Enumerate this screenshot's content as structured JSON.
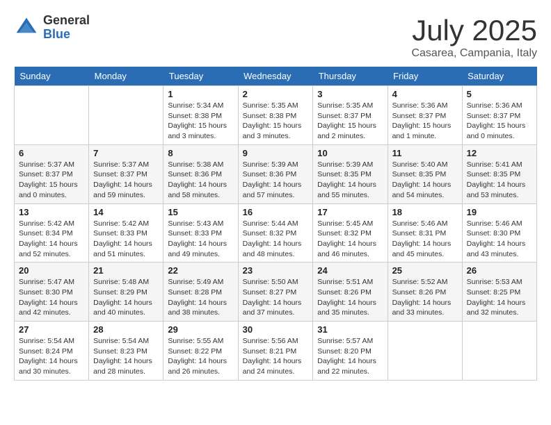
{
  "header": {
    "logo_general": "General",
    "logo_blue": "Blue",
    "month": "July 2025",
    "location": "Casarea, Campania, Italy"
  },
  "weekdays": [
    "Sunday",
    "Monday",
    "Tuesday",
    "Wednesday",
    "Thursday",
    "Friday",
    "Saturday"
  ],
  "weeks": [
    [
      {
        "day": "",
        "info": ""
      },
      {
        "day": "",
        "info": ""
      },
      {
        "day": "1",
        "info": "Sunrise: 5:34 AM\nSunset: 8:38 PM\nDaylight: 15 hours\nand 3 minutes."
      },
      {
        "day": "2",
        "info": "Sunrise: 5:35 AM\nSunset: 8:38 PM\nDaylight: 15 hours\nand 3 minutes."
      },
      {
        "day": "3",
        "info": "Sunrise: 5:35 AM\nSunset: 8:37 PM\nDaylight: 15 hours\nand 2 minutes."
      },
      {
        "day": "4",
        "info": "Sunrise: 5:36 AM\nSunset: 8:37 PM\nDaylight: 15 hours\nand 1 minute."
      },
      {
        "day": "5",
        "info": "Sunrise: 5:36 AM\nSunset: 8:37 PM\nDaylight: 15 hours\nand 0 minutes."
      }
    ],
    [
      {
        "day": "6",
        "info": "Sunrise: 5:37 AM\nSunset: 8:37 PM\nDaylight: 15 hours\nand 0 minutes."
      },
      {
        "day": "7",
        "info": "Sunrise: 5:37 AM\nSunset: 8:37 PM\nDaylight: 14 hours\nand 59 minutes."
      },
      {
        "day": "8",
        "info": "Sunrise: 5:38 AM\nSunset: 8:36 PM\nDaylight: 14 hours\nand 58 minutes."
      },
      {
        "day": "9",
        "info": "Sunrise: 5:39 AM\nSunset: 8:36 PM\nDaylight: 14 hours\nand 57 minutes."
      },
      {
        "day": "10",
        "info": "Sunrise: 5:39 AM\nSunset: 8:35 PM\nDaylight: 14 hours\nand 55 minutes."
      },
      {
        "day": "11",
        "info": "Sunrise: 5:40 AM\nSunset: 8:35 PM\nDaylight: 14 hours\nand 54 minutes."
      },
      {
        "day": "12",
        "info": "Sunrise: 5:41 AM\nSunset: 8:35 PM\nDaylight: 14 hours\nand 53 minutes."
      }
    ],
    [
      {
        "day": "13",
        "info": "Sunrise: 5:42 AM\nSunset: 8:34 PM\nDaylight: 14 hours\nand 52 minutes."
      },
      {
        "day": "14",
        "info": "Sunrise: 5:42 AM\nSunset: 8:33 PM\nDaylight: 14 hours\nand 51 minutes."
      },
      {
        "day": "15",
        "info": "Sunrise: 5:43 AM\nSunset: 8:33 PM\nDaylight: 14 hours\nand 49 minutes."
      },
      {
        "day": "16",
        "info": "Sunrise: 5:44 AM\nSunset: 8:32 PM\nDaylight: 14 hours\nand 48 minutes."
      },
      {
        "day": "17",
        "info": "Sunrise: 5:45 AM\nSunset: 8:32 PM\nDaylight: 14 hours\nand 46 minutes."
      },
      {
        "day": "18",
        "info": "Sunrise: 5:46 AM\nSunset: 8:31 PM\nDaylight: 14 hours\nand 45 minutes."
      },
      {
        "day": "19",
        "info": "Sunrise: 5:46 AM\nSunset: 8:30 PM\nDaylight: 14 hours\nand 43 minutes."
      }
    ],
    [
      {
        "day": "20",
        "info": "Sunrise: 5:47 AM\nSunset: 8:30 PM\nDaylight: 14 hours\nand 42 minutes."
      },
      {
        "day": "21",
        "info": "Sunrise: 5:48 AM\nSunset: 8:29 PM\nDaylight: 14 hours\nand 40 minutes."
      },
      {
        "day": "22",
        "info": "Sunrise: 5:49 AM\nSunset: 8:28 PM\nDaylight: 14 hours\nand 38 minutes."
      },
      {
        "day": "23",
        "info": "Sunrise: 5:50 AM\nSunset: 8:27 PM\nDaylight: 14 hours\nand 37 minutes."
      },
      {
        "day": "24",
        "info": "Sunrise: 5:51 AM\nSunset: 8:26 PM\nDaylight: 14 hours\nand 35 minutes."
      },
      {
        "day": "25",
        "info": "Sunrise: 5:52 AM\nSunset: 8:26 PM\nDaylight: 14 hours\nand 33 minutes."
      },
      {
        "day": "26",
        "info": "Sunrise: 5:53 AM\nSunset: 8:25 PM\nDaylight: 14 hours\nand 32 minutes."
      }
    ],
    [
      {
        "day": "27",
        "info": "Sunrise: 5:54 AM\nSunset: 8:24 PM\nDaylight: 14 hours\nand 30 minutes."
      },
      {
        "day": "28",
        "info": "Sunrise: 5:54 AM\nSunset: 8:23 PM\nDaylight: 14 hours\nand 28 minutes."
      },
      {
        "day": "29",
        "info": "Sunrise: 5:55 AM\nSunset: 8:22 PM\nDaylight: 14 hours\nand 26 minutes."
      },
      {
        "day": "30",
        "info": "Sunrise: 5:56 AM\nSunset: 8:21 PM\nDaylight: 14 hours\nand 24 minutes."
      },
      {
        "day": "31",
        "info": "Sunrise: 5:57 AM\nSunset: 8:20 PM\nDaylight: 14 hours\nand 22 minutes."
      },
      {
        "day": "",
        "info": ""
      },
      {
        "day": "",
        "info": ""
      }
    ]
  ]
}
